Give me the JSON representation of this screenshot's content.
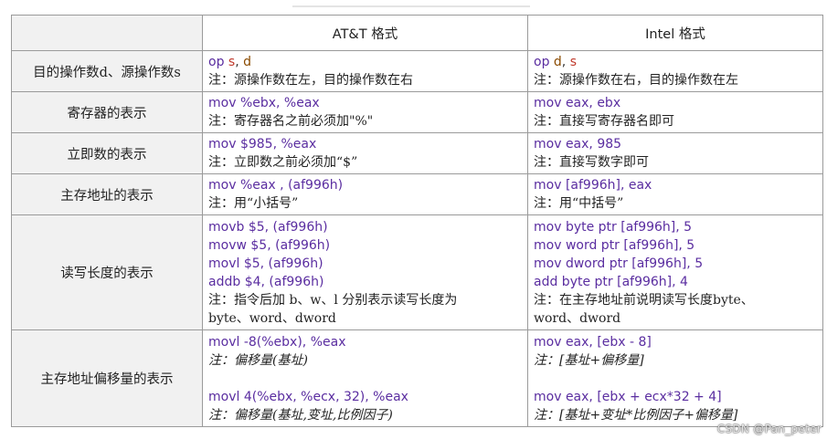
{
  "header": {
    "att": "AT&T 格式",
    "intel": "Intel 格式"
  },
  "rows": [
    {
      "label": "目的操作数d、源操作数s",
      "att": [
        "op s, d",
        "注：源操作数在左，目的操作数在右"
      ],
      "intel": [
        "op d, s",
        "注：源操作数在右，目的操作数在左"
      ]
    },
    {
      "label": "寄存器的表示",
      "att": [
        "mov %ebx, %eax",
        "注：寄存器名之前必须加\"%\""
      ],
      "intel": [
        "mov eax, ebx",
        "注：直接写寄存器名即可"
      ]
    },
    {
      "label": "立即数的表示",
      "att": [
        "mov $985, %eax",
        "注：立即数之前必须加“$”"
      ],
      "intel": [
        "mov eax, 985",
        "注：直接写数字即可"
      ]
    },
    {
      "label": "主存地址的表示",
      "att": [
        "mov %eax , (af996h)",
        "注：用“小括号”"
      ],
      "intel": [
        "mov [af996h], eax",
        "注：用“中括号”"
      ]
    },
    {
      "label": "读写长度的表示",
      "att": [
        "movb $5, (af996h)",
        "movw $5, (af996h)",
        "movl $5, (af996h)",
        "addb $4, (af996h)",
        "注：指令后加 b、w、l 分别表示读写长度为",
        "byte、word、dword"
      ],
      "intel": [
        "mov byte ptr [af996h], 5",
        "mov word ptr [af996h], 5",
        "mov dword ptr [af996h], 5",
        "add byte ptr [af996h], 4",
        "注：在主存地址前说明读写长度byte、",
        "word、dword"
      ]
    },
    {
      "label": "主存地址偏移量的表示",
      "att": [
        "movl -8(%ebx), %eax",
        "注：偏移量(基址)",
        "movl 4(%ebx, %ecx, 32), %eax",
        "注：偏移量(基址,变址,比例因子)"
      ],
      "intel": [
        "mov eax, [ebx - 8]",
        "注：[基址+偏移量]",
        "mov eax, [ebx + ecx*32 + 4]",
        "注：[基址+变址*比例因子+偏移量]"
      ]
    }
  ],
  "watermark": "CSDN @Pan_peter",
  "colors": {
    "keyword": "#5a2da0",
    "register": "#c0392b",
    "operand": "#8a4a00",
    "label_bg": "#f1f1f1",
    "border": "#9a9a9a"
  }
}
